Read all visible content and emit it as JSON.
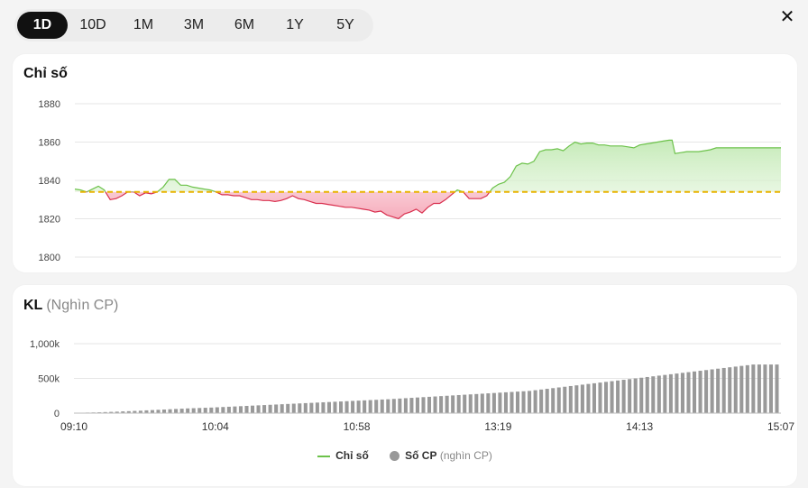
{
  "tabs": [
    {
      "label": "1D",
      "active": true
    },
    {
      "label": "10D",
      "active": false
    },
    {
      "label": "1M",
      "active": false
    },
    {
      "label": "3M",
      "active": false
    },
    {
      "label": "6M",
      "active": false
    },
    {
      "label": "1Y",
      "active": false
    },
    {
      "label": "5Y",
      "active": false
    }
  ],
  "close_label": "✕",
  "index_card": {
    "title": "Chỉ số"
  },
  "volume_card": {
    "title": "KL",
    "subtitle": "(Nghìn CP)"
  },
  "legend": {
    "index_label": "Chỉ số",
    "volume_label": "Số CP",
    "volume_unit": "(nghìn CP)"
  },
  "colors": {
    "up": "#6cc24a",
    "down": "#d9304f",
    "reference": "#e8b400",
    "volume": "#999999"
  },
  "chart_data": [
    {
      "type": "line",
      "title": "Chỉ số",
      "reference": 1834,
      "yticks": [
        1880,
        1860,
        1840,
        1820,
        1800
      ],
      "ylim": [
        1800,
        1880
      ],
      "x_count": 120,
      "points": [
        [
          0,
          1835.5
        ],
        [
          2,
          1835
        ],
        [
          4,
          1834
        ],
        [
          6,
          1835.5
        ],
        [
          8,
          1837
        ],
        [
          10,
          1835
        ],
        [
          12,
          1830
        ],
        [
          14,
          1830.5
        ],
        [
          16,
          1832
        ],
        [
          18,
          1834
        ],
        [
          20,
          1834
        ],
        [
          22,
          1832
        ],
        [
          24,
          1833.5
        ],
        [
          26,
          1833
        ],
        [
          28,
          1834
        ],
        [
          30,
          1836.5
        ],
        [
          32,
          1840.5
        ],
        [
          34,
          1840.5
        ],
        [
          36,
          1837.5
        ],
        [
          38,
          1837.5
        ],
        [
          40,
          1836.5
        ],
        [
          42,
          1836
        ],
        [
          44,
          1835.5
        ],
        [
          46,
          1835
        ],
        [
          48,
          1834
        ],
        [
          50,
          1832.5
        ],
        [
          52,
          1832.5
        ],
        [
          54,
          1832
        ],
        [
          56,
          1832
        ],
        [
          58,
          1831
        ],
        [
          60,
          1830
        ],
        [
          62,
          1830
        ],
        [
          64,
          1829.5
        ],
        [
          66,
          1829.5
        ],
        [
          68,
          1829
        ],
        [
          70,
          1829.5
        ],
        [
          72,
          1830.5
        ],
        [
          74,
          1832
        ],
        [
          76,
          1830.5
        ],
        [
          78,
          1830
        ],
        [
          80,
          1829
        ],
        [
          82,
          1828
        ],
        [
          84,
          1828
        ],
        [
          86,
          1827.5
        ],
        [
          88,
          1827
        ],
        [
          90,
          1826.5
        ],
        [
          92,
          1826
        ],
        [
          94,
          1826
        ],
        [
          96,
          1825.5
        ],
        [
          98,
          1825
        ],
        [
          100,
          1824.5
        ],
        [
          102,
          1823.5
        ],
        [
          104,
          1824
        ],
        [
          106,
          1822
        ],
        [
          108,
          1821
        ],
        [
          110,
          1820
        ],
        [
          112,
          1822.5
        ],
        [
          114,
          1823.5
        ],
        [
          116,
          1825
        ],
        [
          118,
          1823
        ],
        [
          120,
          1826
        ],
        [
          122,
          1828
        ],
        [
          124,
          1828
        ],
        [
          126,
          1830
        ],
        [
          128,
          1832.5
        ],
        [
          130,
          1835
        ],
        [
          132,
          1834
        ],
        [
          134,
          1830.5
        ],
        [
          136,
          1830.5
        ],
        [
          138,
          1830.5
        ],
        [
          140,
          1832
        ],
        [
          142,
          1836
        ],
        [
          144,
          1838
        ],
        [
          146,
          1839
        ],
        [
          148,
          1842
        ],
        [
          150,
          1847.5
        ],
        [
          152,
          1849
        ],
        [
          154,
          1848.5
        ],
        [
          156,
          1850
        ],
        [
          158,
          1855
        ],
        [
          160,
          1856
        ],
        [
          162,
          1856
        ],
        [
          164,
          1856.5
        ],
        [
          166,
          1855.5
        ],
        [
          168,
          1858
        ],
        [
          170,
          1860
        ],
        [
          172,
          1859
        ],
        [
          174,
          1859.5
        ],
        [
          176,
          1859.5
        ],
        [
          178,
          1858.5
        ],
        [
          180,
          1858.5
        ],
        [
          182,
          1858
        ],
        [
          184,
          1858
        ],
        [
          186,
          1858
        ],
        [
          188,
          1857.5
        ],
        [
          190,
          1857
        ],
        [
          192,
          1858.5
        ],
        [
          194,
          1859
        ],
        [
          196,
          1859.5
        ],
        [
          198,
          1860
        ],
        [
          200,
          1860.5
        ],
        [
          202,
          1861
        ],
        [
          203,
          1861
        ],
        [
          204,
          1854
        ],
        [
          206,
          1854.5
        ],
        [
          208,
          1855
        ],
        [
          210,
          1855
        ],
        [
          212,
          1855
        ],
        [
          214,
          1855.5
        ],
        [
          216,
          1856
        ],
        [
          218,
          1857
        ],
        [
          220,
          1857
        ],
        [
          240,
          1857
        ]
      ]
    },
    {
      "type": "bar",
      "title": "KL",
      "ylabel": "(Nghìn CP)",
      "yticks": [
        "1,000k",
        "500k",
        "0"
      ],
      "ylim": [
        0,
        1000
      ],
      "x_tick_labels": [
        "09:10",
        "10:04",
        "10:58",
        "13:19",
        "14:13",
        "15:07"
      ],
      "values": [
        3,
        6,
        8,
        10,
        12,
        15,
        18,
        21,
        25,
        28,
        32,
        35,
        40,
        44,
        48,
        52,
        56,
        60,
        64,
        68,
        71,
        74,
        77,
        80,
        84,
        88,
        92,
        96,
        100,
        104,
        108,
        112,
        116,
        120,
        124,
        128,
        132,
        136,
        140,
        144,
        148,
        152,
        156,
        160,
        164,
        168,
        172,
        176,
        180,
        184,
        188,
        192,
        196,
        200,
        205,
        210,
        215,
        220,
        225,
        230,
        235,
        240,
        245,
        250,
        255,
        260,
        265,
        270,
        275,
        280,
        285,
        290,
        295,
        300,
        305,
        310,
        315,
        320,
        330,
        340,
        350,
        360,
        370,
        380,
        390,
        400,
        410,
        420,
        430,
        440,
        450,
        460,
        470,
        480,
        490,
        500,
        510,
        520,
        530,
        540,
        550,
        560,
        570,
        580,
        590,
        600,
        610,
        620,
        630,
        640,
        650,
        660,
        670,
        680,
        690,
        700,
        700,
        700,
        700,
        700
      ]
    }
  ]
}
